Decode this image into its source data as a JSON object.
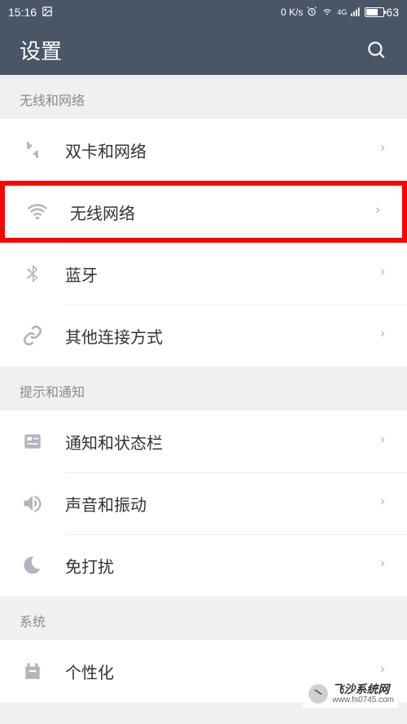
{
  "status": {
    "time": "15:16",
    "speed": "0 K/s",
    "battery": "63",
    "network_type": "4G"
  },
  "header": {
    "title": "设置"
  },
  "sections": [
    {
      "title": "无线和网络",
      "items": [
        {
          "label": "双卡和网络",
          "icon": "sim-icon",
          "highlight": false
        },
        {
          "label": "无线网络",
          "icon": "wifi-icon",
          "highlight": true
        },
        {
          "label": "蓝牙",
          "icon": "bluetooth-icon",
          "highlight": false
        },
        {
          "label": "其他连接方式",
          "icon": "link-icon",
          "highlight": false
        }
      ]
    },
    {
      "title": "提示和通知",
      "items": [
        {
          "label": "通知和状态栏",
          "icon": "notification-icon",
          "highlight": false
        },
        {
          "label": "声音和振动",
          "icon": "sound-icon",
          "highlight": false
        },
        {
          "label": "免打扰",
          "icon": "dnd-icon",
          "highlight": false
        }
      ]
    },
    {
      "title": "系统",
      "items": [
        {
          "label": "个性化",
          "icon": "personalization-icon",
          "highlight": false
        }
      ]
    }
  ],
  "watermark": {
    "title": "飞沙系统网",
    "url": "www.fs0745.com"
  }
}
